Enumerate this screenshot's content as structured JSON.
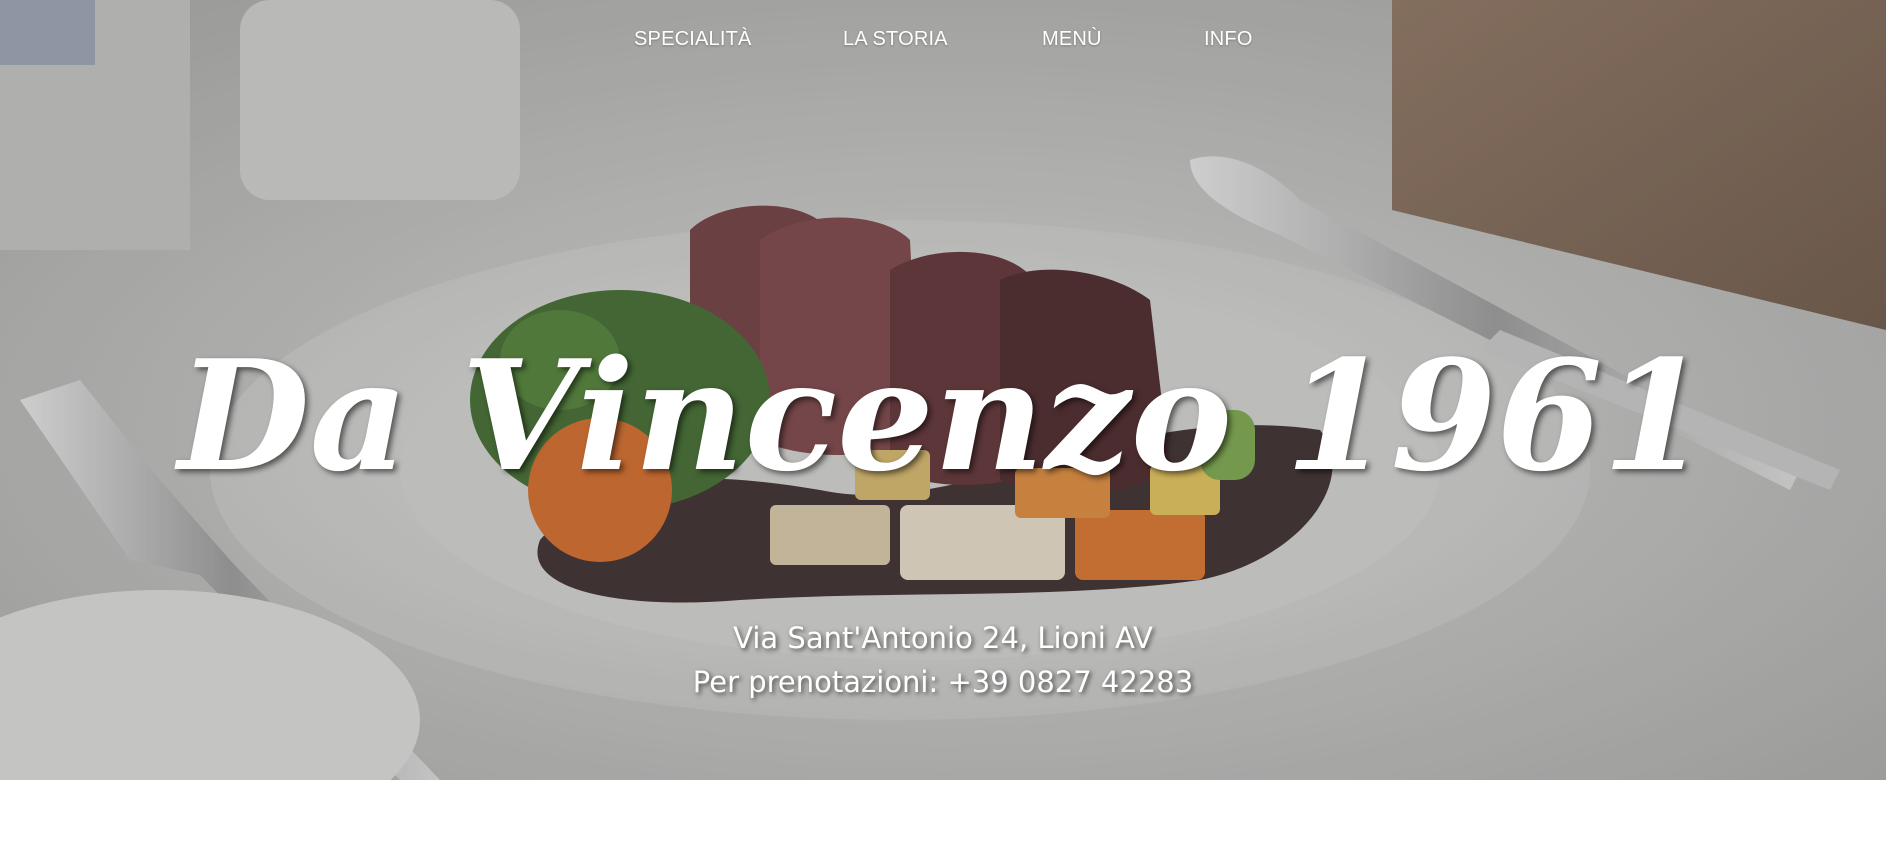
{
  "nav": {
    "items": [
      {
        "label": "SPECIALITÀ"
      },
      {
        "label": "LA STORIA"
      },
      {
        "label": "MENÙ"
      },
      {
        "label": "INFO"
      }
    ]
  },
  "hero": {
    "title": "Da Vincenzo 1961",
    "address": "Via Sant'Antonio 24, Lioni AV",
    "phone": "Per prenotazioni: +39 0827 42283",
    "image": "plated-steak-with-vegetables"
  },
  "colors": {
    "text": "#ffffff",
    "overlay": "#9c9c9c",
    "page_background": "#ffffff"
  }
}
